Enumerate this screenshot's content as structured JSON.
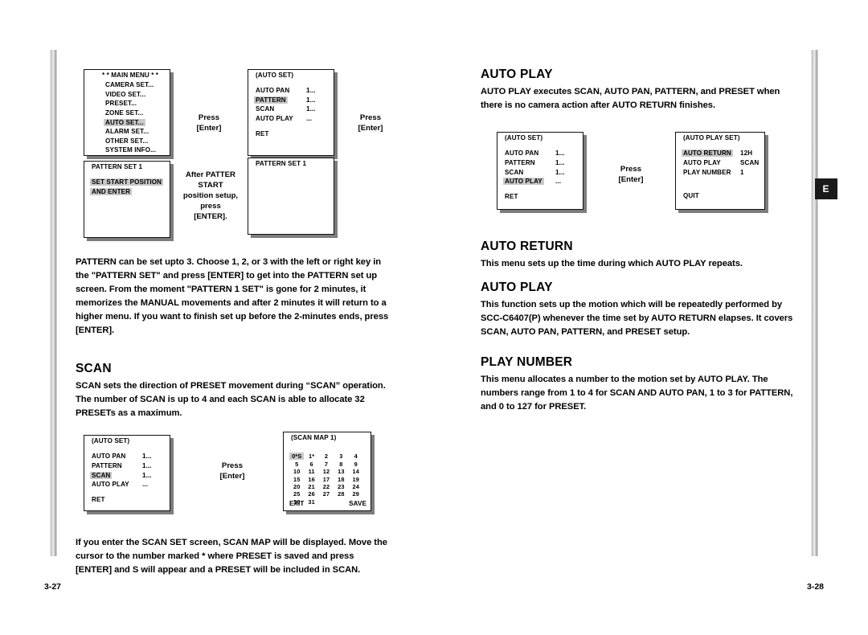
{
  "page": {
    "left_page_number": "3-27",
    "right_page_number": "3-28",
    "side_tab": "E"
  },
  "left_column": {
    "diagram_pattern": {
      "main_menu_box": {
        "title": "* *  MAIN MENU * *",
        "items": [
          {
            "label": "CAMERA SET...",
            "highlight": false
          },
          {
            "label": "VIDEO SET...",
            "highlight": false
          },
          {
            "label": "PRESET...",
            "highlight": false
          },
          {
            "label": "ZONE SET...",
            "highlight": false
          },
          {
            "label": "AUTO SET...",
            "highlight": true
          },
          {
            "label": "ALARM SET...",
            "highlight": false
          },
          {
            "label": "OTHER SET...",
            "highlight": false
          },
          {
            "label": "SYSTEM INFO...",
            "highlight": false
          }
        ]
      },
      "press_enter_1": "Press\n[Enter]",
      "press_enter_1_line1": "Press",
      "press_enter_1_line2": "[Enter]",
      "auto_set_box": {
        "title": "(AUTO SET)",
        "items": [
          {
            "label": "AUTO PAN",
            "value": "1...",
            "highlight": false
          },
          {
            "label": "PATTERN",
            "value": "1...",
            "highlight": true
          },
          {
            "label": "SCAN",
            "value": "1...",
            "highlight": false
          },
          {
            "label": "AUTO PLAY",
            "value": "...",
            "highlight": false
          }
        ],
        "footer": "RET"
      },
      "press_enter_2_line1": "Press",
      "press_enter_2_line2": "[Enter]",
      "pattern_set_box": {
        "title": "PATTERN SET 1",
        "items": [
          {
            "label": "SET START POSITION",
            "highlight": true
          },
          {
            "label": "AND ENTER",
            "highlight": true
          }
        ]
      },
      "after_pattern_note": "After PATTER\nSTART\nposition setup,\npress\n[ENTER].",
      "after_pattern_lines": [
        "After PATTER",
        "START",
        "position setup,",
        "press",
        "[ENTER]."
      ],
      "pattern_set_box_2": {
        "title": "PATTERN SET 1"
      }
    },
    "pattern_paragraph": "PATTERN can be set upto 3.  Choose 1, 2, or 3 with the left or right key in the \"PATTERN SET\" and press [ENTER] to get into the PATTERN set up screen. From the moment \"PATTERN 1 SET\"  is gone for 2 minutes, it memorizes the MANUAL movements and after 2 minutes it will return to a higher menu. If you want to finish set up before the 2-minutes ends, press [ENTER].",
    "scan_heading": "SCAN",
    "scan_paragraph": "SCAN sets the direction of PRESET movement during “SCAN” operation. The number of SCAN is up to 4 and each SCAN is able to allocate 32 PRESETs as a maximum.",
    "diagram_scan": {
      "auto_set_box": {
        "title": "(AUTO SET)",
        "items": [
          {
            "label": "AUTO PAN",
            "value": "1...",
            "highlight": false
          },
          {
            "label": "PATTERN",
            "value": "1...",
            "highlight": false
          },
          {
            "label": "SCAN",
            "value": "1...",
            "highlight": true
          },
          {
            "label": "AUTO PLAY",
            "value": "...",
            "highlight": false
          }
        ],
        "footer": "RET"
      },
      "press_enter_line1": "Press",
      "press_enter_line2": "[Enter]",
      "scan_map_box": {
        "title": "(SCAN MAP 1)",
        "grid": [
          [
            "0*S",
            "1*",
            "2",
            "3",
            "4"
          ],
          [
            "5",
            "6",
            "7",
            "8",
            "9"
          ],
          [
            "10",
            "11",
            "12",
            "13",
            "14"
          ],
          [
            "15",
            "16",
            "17",
            "18",
            "19"
          ],
          [
            "20",
            "21",
            "22",
            "23",
            "24"
          ],
          [
            "25",
            "26",
            "27",
            "28",
            "29"
          ],
          [
            "30",
            "31",
            "",
            "",
            ""
          ]
        ],
        "cursor_cell": "0*S",
        "footer_left": "EXIT",
        "footer_right": "SAVE"
      }
    },
    "scan_map_paragraph": "If you enter the SCAN SET screen, SCAN MAP will be displayed. Move the cursor to the number marked * where PRESET is saved and press [ENTER] and S will appear and a PRESET will be included in SCAN."
  },
  "right_column": {
    "auto_play_heading": "AUTO PLAY",
    "auto_play_paragraph": "AUTO PLAY executes SCAN, AUTO PAN, PATTERN, and PRESET when there is no camera action after AUTO RETURN finishes.",
    "diagram_autoplay": {
      "auto_set_box": {
        "title": "(AUTO SET)",
        "items": [
          {
            "label": "AUTO PAN",
            "value": "1...",
            "highlight": false
          },
          {
            "label": "PATTERN",
            "value": "1...",
            "highlight": false
          },
          {
            "label": "SCAN",
            "value": "1...",
            "highlight": false
          },
          {
            "label": "AUTO PLAY",
            "value": "...",
            "highlight": true
          }
        ],
        "footer": "RET"
      },
      "press_enter_line1": "Press",
      "press_enter_line2": "[Enter]",
      "auto_play_set_box": {
        "title": "(AUTO PLAY SET)",
        "items": [
          {
            "label": "AUTO RETURN",
            "value": "12H",
            "highlight": true
          },
          {
            "label": "AUTO PLAY",
            "value": "SCAN",
            "highlight": false
          },
          {
            "label": "PLAY NUMBER",
            "value": "1",
            "highlight": false
          }
        ],
        "footer": "QUIT"
      }
    },
    "auto_return_heading": "AUTO RETURN",
    "auto_return_paragraph": "This menu sets up the time during which AUTO PLAY repeats.",
    "auto_play_heading_2": "AUTO PLAY",
    "auto_play_paragraph_2": "This function sets up the motion which will be repeatedly performed by SCC-C6407(P) whenever the time set by AUTO RETURN elapses. It covers SCAN, AUTO PAN, PATTERN, and PRESET setup.",
    "play_number_heading": "PLAY NUMBER",
    "play_number_paragraph": "This menu allocates a number to the motion set by AUTO PLAY. The numbers range from 1 to 4 for SCAN AND AUTO PAN, 1 to 3 for PATTERN, and 0 to 127 for PRESET."
  },
  "colors": {
    "highlight": "#c9c9c9",
    "border": "#111111",
    "shadow": "#7d7d7d",
    "tab_bg": "#1a1a1a"
  }
}
